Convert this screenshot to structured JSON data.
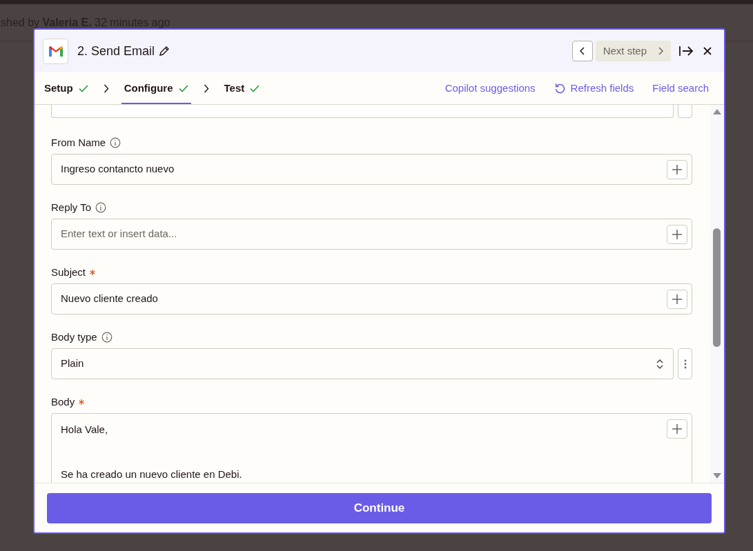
{
  "background": {
    "published_prefix": "shed by",
    "author": "Valeria E.",
    "time": "32 minutes ago"
  },
  "header": {
    "title": "2. Send Email",
    "next_step": "Next step"
  },
  "steps": [
    {
      "label": "Setup",
      "done": true,
      "selected": false
    },
    {
      "label": "Configure",
      "done": true,
      "selected": true
    },
    {
      "label": "Test",
      "done": true,
      "selected": false
    }
  ],
  "actions": [
    {
      "label": "Copilot suggestions",
      "kind": "link"
    },
    {
      "label": "Refresh fields",
      "kind": "refresh"
    },
    {
      "label": "Field search",
      "kind": "link"
    }
  ],
  "fields": [
    {
      "kind": "select-cut"
    },
    {
      "kind": "input",
      "label": "From Name",
      "info": true,
      "required": false,
      "value": "Ingreso contancto nuevo"
    },
    {
      "kind": "input",
      "label": "Reply To",
      "info": true,
      "required": false,
      "placeholder": "Enter text or insert data..."
    },
    {
      "kind": "input",
      "label": "Subject",
      "info": false,
      "required": true,
      "value": "Nuevo cliente creado"
    },
    {
      "kind": "select",
      "label": "Body type",
      "info": true,
      "required": false,
      "value": "Plain"
    },
    {
      "kind": "textarea",
      "label": "Body",
      "info": false,
      "required": true,
      "lines": [
        "Hola Vale,",
        "Se ha creado un nuevo cliente en Debi."
      ]
    }
  ],
  "continue_button": "Continue"
}
